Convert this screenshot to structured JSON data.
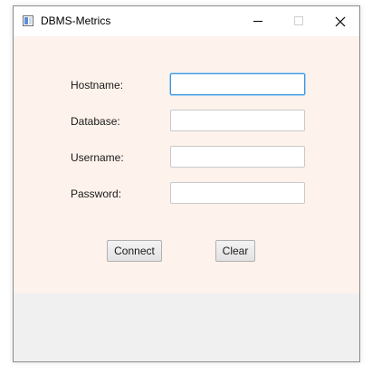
{
  "window": {
    "title": "DBMS-Metrics",
    "icon": "app-window-icon",
    "controls": {
      "minimize": "minimize-icon",
      "maximize": "maximize-icon",
      "close": "close-icon"
    }
  },
  "form": {
    "hostname": {
      "label": "Hostname:",
      "value": "",
      "placeholder": ""
    },
    "database": {
      "label": "Database:",
      "value": "",
      "placeholder": ""
    },
    "username": {
      "label": "Username:",
      "value": "",
      "placeholder": ""
    },
    "password": {
      "label": "Password:",
      "value": "",
      "placeholder": ""
    }
  },
  "actions": {
    "connect_label": "Connect",
    "clear_label": "Clear"
  },
  "colors": {
    "content_background": "#fdf2ec",
    "frame_background": "#f0f0f0",
    "focus_accent": "#3f97db"
  }
}
